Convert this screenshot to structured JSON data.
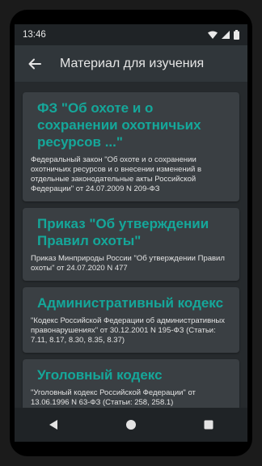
{
  "status_bar": {
    "time": "13:46",
    "icons": [
      "wifi-icon",
      "signal-icon",
      "battery-icon"
    ]
  },
  "app_bar": {
    "title": "Материал для изучения",
    "back_icon": "arrow-back-icon"
  },
  "colors": {
    "accent": "#15a79a",
    "card_bg": "#3a3f43",
    "screen_bg": "#262a2d",
    "app_bar_bg": "#30363a"
  },
  "materials": [
    {
      "title": "ФЗ \"Об охоте и о сохранении охотничьих ресурсов ...\"",
      "description": "Федеральный закон \"Об охоте и о сохранении охотничьих ресурсов и о внесении изменений в отдельные законодательные акты Российской Федерации\" от 24.07.2009 N 209-ФЗ"
    },
    {
      "title": "Приказ \"Об утверждении Правил охоты\"",
      "description": "Приказ Минприроды России \"Об утверждении Правил охоты\" от 24.07.2020 N 477"
    },
    {
      "title": "Административный кодекс",
      "description": "\"Кодекс Российской Федерации об административных правонарушениях\" от 30.12.2001 N 195-ФЗ (Статьи: 7.11, 8.17, 8.30, 8.35, 8.37)"
    },
    {
      "title": "Уголовный кодекс",
      "description": "\"Уголовный кодекс Российской Федерации\" от 13.06.1996 N 63-ФЗ (Статьи: 258, 258.1)"
    }
  ],
  "nav_bar": {
    "icons": [
      "back-triangle-icon",
      "home-circle-icon",
      "recents-square-icon"
    ]
  }
}
